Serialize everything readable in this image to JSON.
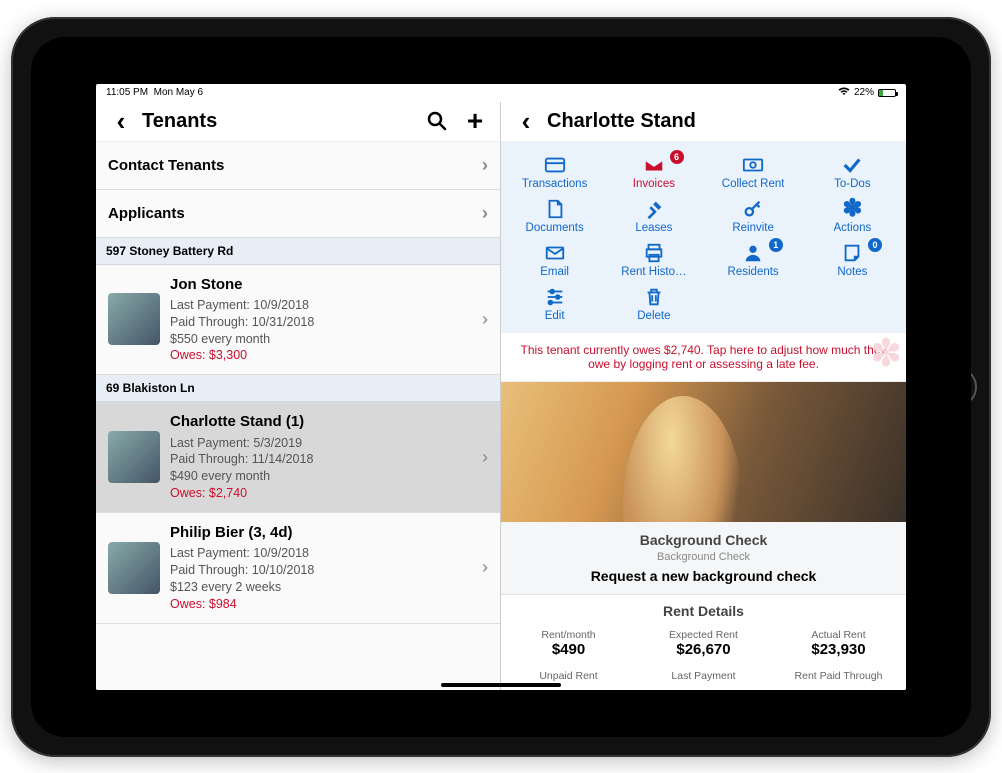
{
  "statusbar": {
    "time": "11:05 PM",
    "date": "Mon May 6",
    "battery": "22%"
  },
  "left": {
    "title": "Tenants",
    "menu": {
      "contact": "Contact Tenants",
      "applicants": "Applicants"
    },
    "sections": [
      {
        "address": "597 Stoney Battery Rd",
        "tenants": [
          {
            "name": "Jon Stone",
            "lastPayment": "Last Payment: 10/9/2018",
            "paidThrough": "Paid Through: 10/31/2018",
            "rent": "$550 every month",
            "owes": "Owes: $3,300"
          }
        ]
      },
      {
        "address": "69 Blakiston Ln",
        "tenants": [
          {
            "name": "Charlotte Stand (1)",
            "lastPayment": "Last Payment: 5/3/2019",
            "paidThrough": "Paid Through: 11/14/2018",
            "rent": "$490 every month",
            "owes": "Owes: $2,740"
          },
          {
            "name": "Philip Bier (3, 4d)",
            "lastPayment": "Last Payment: 10/9/2018",
            "paidThrough": "Paid Through: 10/10/2018",
            "rent": "$123 every 2 weeks",
            "owes": "Owes: $984"
          }
        ]
      }
    ]
  },
  "right": {
    "title": "Charlotte Stand",
    "actions": {
      "transactions": "Transactions",
      "invoices": "Invoices",
      "invoicesBadge": "6",
      "collectRent": "Collect Rent",
      "todos": "To-Dos",
      "documents": "Documents",
      "leases": "Leases",
      "reinvite": "Reinvite",
      "moreActions": "Actions",
      "email": "Email",
      "rentHistory": "Rent Histo…",
      "residents": "Residents",
      "residentsBadge": "1",
      "notes": "Notes",
      "notesBadge": "0",
      "edit": "Edit",
      "delete": "Delete"
    },
    "alert": "This tenant currently owes $2,740. Tap here to adjust how much they owe by logging rent or assessing a late fee.",
    "background": {
      "heading": "Background Check",
      "sub": "Background Check",
      "link": "Request a new background check"
    },
    "rent": {
      "heading": "Rent Details",
      "row1": [
        {
          "lbl": "Rent/month",
          "val": "$490"
        },
        {
          "lbl": "Expected Rent",
          "val": "$26,670"
        },
        {
          "lbl": "Actual Rent",
          "val": "$23,930"
        }
      ],
      "row2": [
        {
          "lbl": "Unpaid Rent"
        },
        {
          "lbl": "Last Payment"
        },
        {
          "lbl": "Rent Paid Through"
        }
      ]
    }
  }
}
